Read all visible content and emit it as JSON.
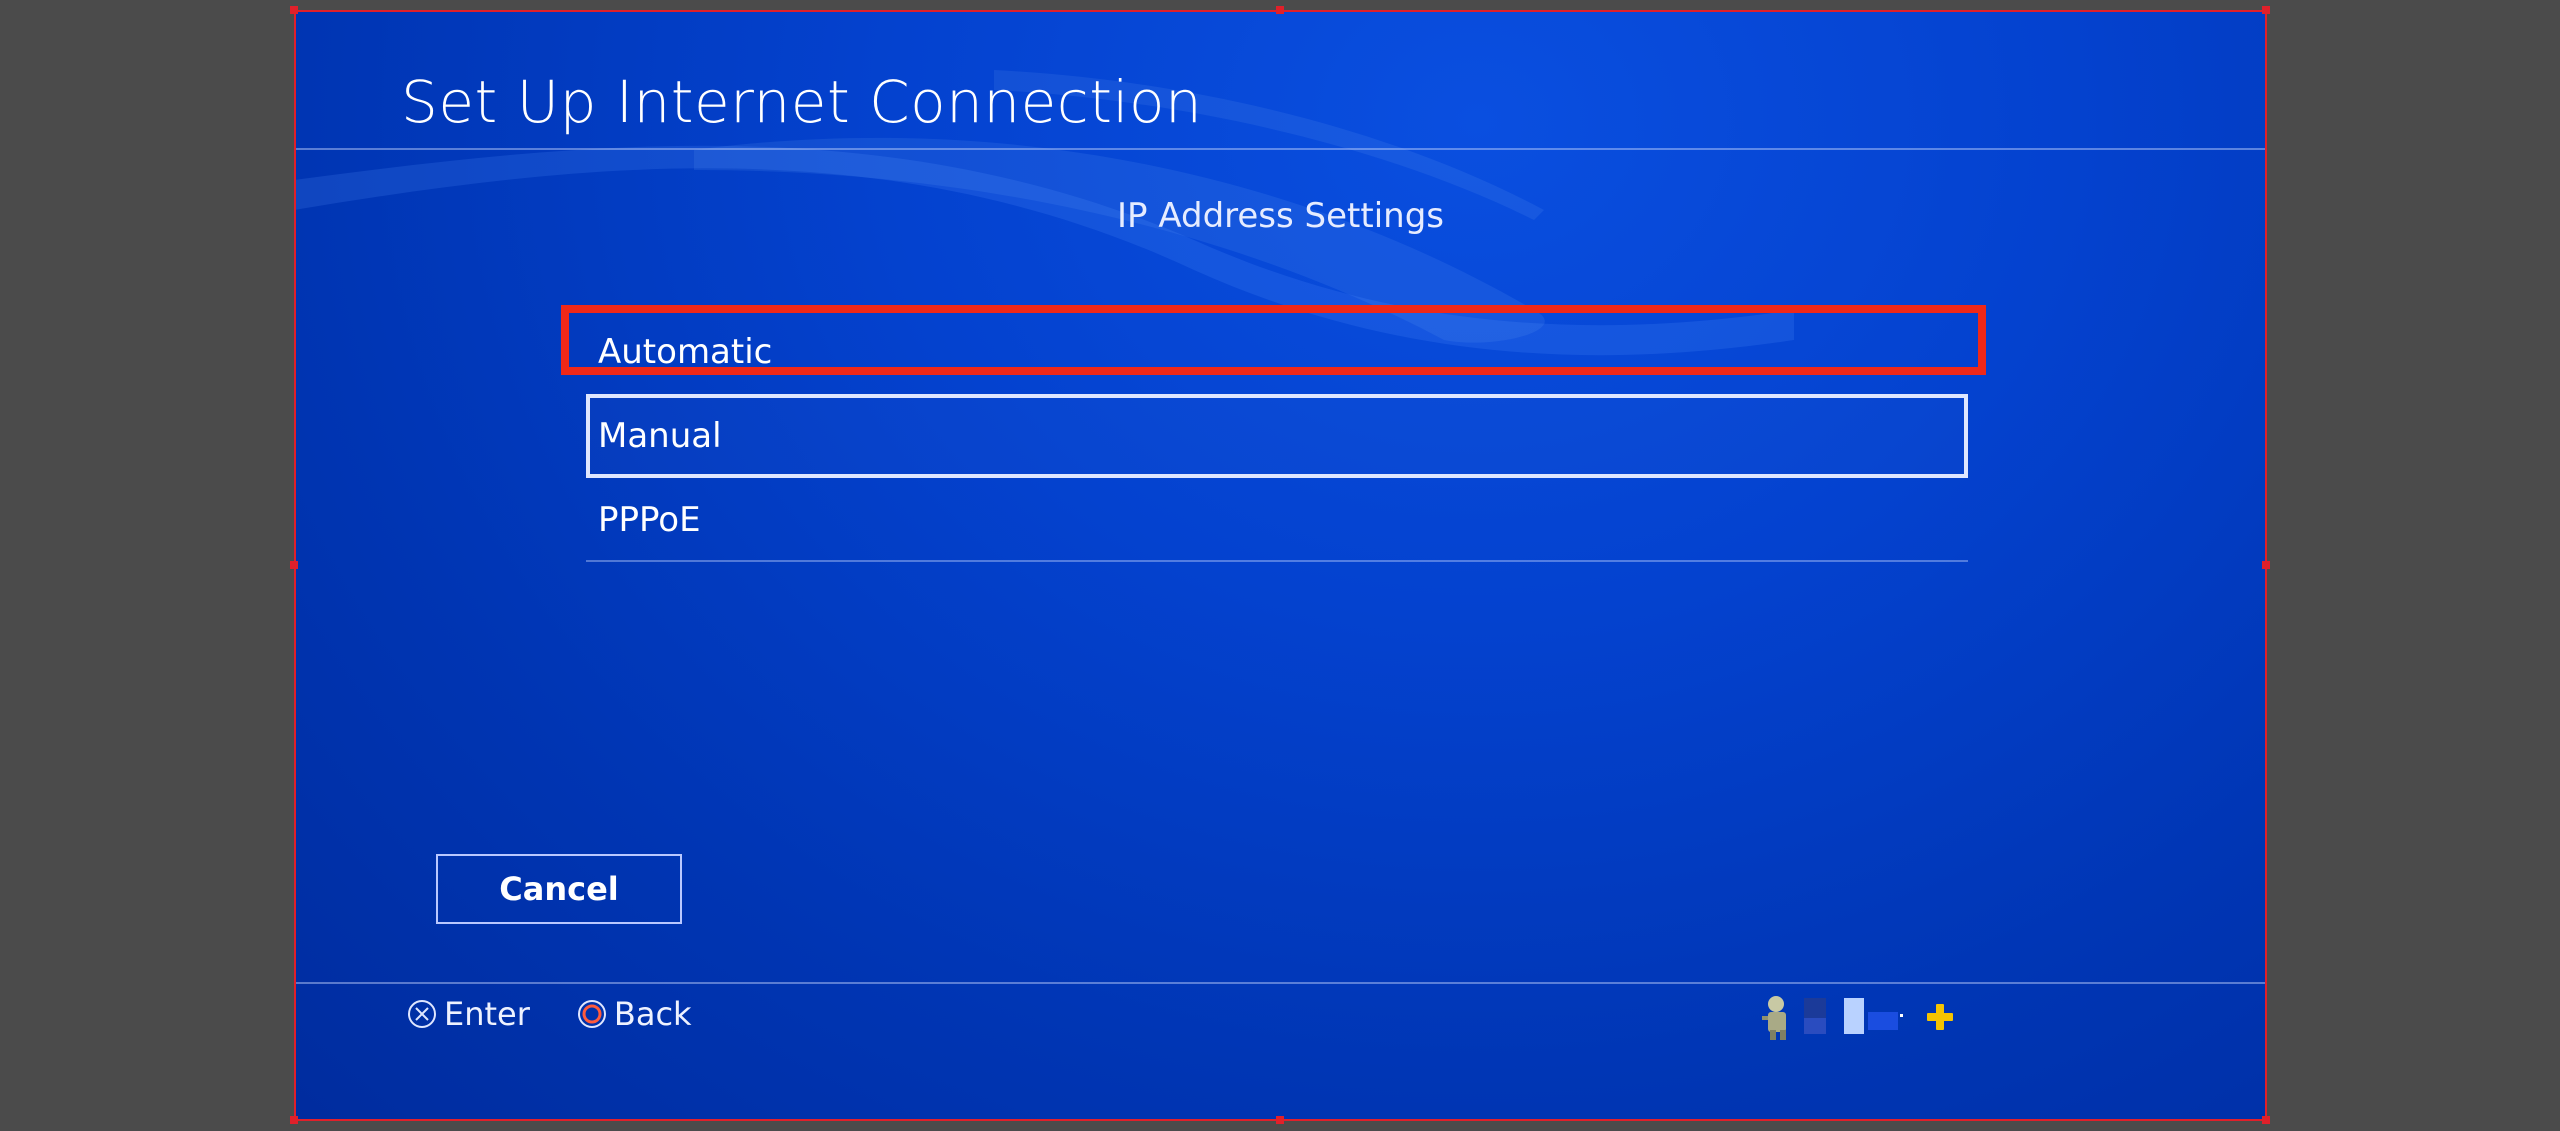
{
  "screen": {
    "title": "Set Up Internet Connection",
    "subtitle": "IP Address Settings",
    "options": [
      {
        "label": "Automatic",
        "state": "highlighted"
      },
      {
        "label": "Manual",
        "state": "focused"
      },
      {
        "label": "PPPoE",
        "state": "normal"
      }
    ],
    "cancel_label": "Cancel",
    "hints": {
      "enter_label": "Enter",
      "back_label": "Back"
    },
    "status_icons": [
      "avatar-icon",
      "status-blocks-icon",
      "playstation-plus-icon"
    ]
  },
  "colors": {
    "annotation_red": "#f02818",
    "selection_frame": "#e0202a",
    "background_blue": "#0442cf",
    "plus_yellow": "#f5c400"
  }
}
